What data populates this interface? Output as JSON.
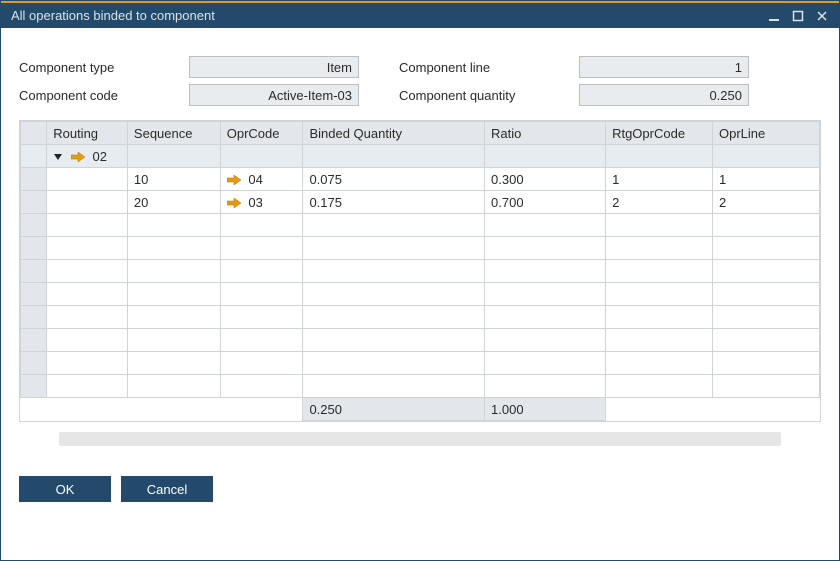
{
  "window": {
    "title": "All operations binded to component"
  },
  "form": {
    "component_type": {
      "label": "Component type",
      "value": "Item"
    },
    "component_code": {
      "label": "Component code",
      "value": "Active-Item-03"
    },
    "component_line": {
      "label": "Component line",
      "value": "1"
    },
    "component_quantity": {
      "label": "Component quantity",
      "value": "0.250"
    }
  },
  "grid": {
    "headers": {
      "routing": "Routing",
      "sequence": "Sequence",
      "opr_code": "OprCode",
      "binded_qty": "Binded Quantity",
      "ratio": "Ratio",
      "rtg_opr_code": "RtgOprCode",
      "opr_line": "OprLine"
    },
    "parent": {
      "routing": "02"
    },
    "rows": [
      {
        "sequence": "10",
        "opr_code": "04",
        "binded_qty": "0.075",
        "ratio": "0.300",
        "rtg_opr_code": "1",
        "opr_line": "1"
      },
      {
        "sequence": "20",
        "opr_code": "03",
        "binded_qty": "0.175",
        "ratio": "0.700",
        "rtg_opr_code": "2",
        "opr_line": "2"
      }
    ],
    "totals": {
      "binded_qty": "0.250",
      "ratio": "1.000"
    }
  },
  "buttons": {
    "ok": "OK",
    "cancel": "Cancel"
  }
}
